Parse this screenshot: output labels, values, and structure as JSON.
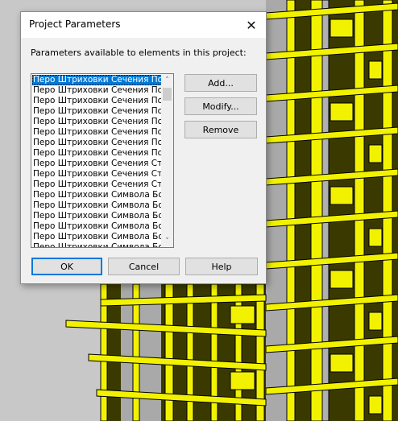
{
  "dialog": {
    "title": "Project Parameters",
    "close_glyph": "✕",
    "prompt": "Parameters available to elements in this project:",
    "parameters": [
      "Перо Штриховки Сечения Подо",
      "Перо Штриховки Сечения Подо",
      "Перо Штриховки Сечения Подо",
      "Перо Штриховки Сечения Подо",
      "Перо Штриховки Сечения Поро",
      "Перо Штриховки Сечения Поро",
      "Перо Штриховки Сечения Поро",
      "Перо Штриховки Сечения Поро",
      "Перо Штриховки Сечения Став",
      "Перо Штриховки Сечения Став",
      "Перо Штриховки Сечения Став",
      "Перо Штриховки Символа Боко",
      "Перо Штриховки Символа Боко",
      "Перо Штриховки Символа Боко",
      "Перо Штриховки Символа Боко",
      "Перо Штриховки Символа Боко",
      "Перо Штриховки Символа Боко"
    ],
    "selected_index": 0,
    "scroll_up_glyph": "˄",
    "scroll_down_glyph": "˅",
    "buttons": {
      "add": "Add...",
      "modify": "Modify...",
      "remove": "Remove",
      "ok": "OK",
      "cancel": "Cancel",
      "help": "Help"
    }
  },
  "background": {
    "model_color": "#f2f200",
    "glass_color": "#3a3a00",
    "sky_color": "#c8c8c8",
    "edge_color": "#000000"
  }
}
